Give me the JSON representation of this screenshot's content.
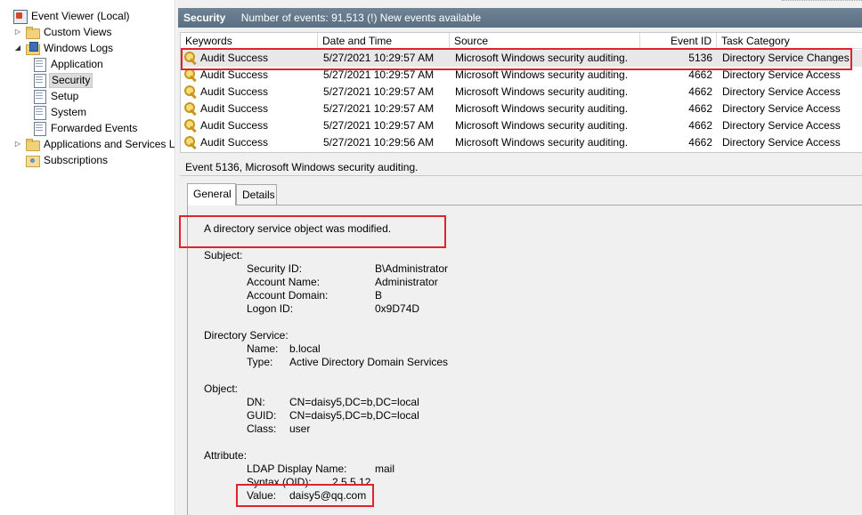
{
  "tree": {
    "items": [
      {
        "label": "Event Viewer (Local)",
        "icon": "event-viewer-icon",
        "expander": ""
      },
      {
        "label": "Custom Views",
        "icon": "folder-icon",
        "expander": "▷"
      },
      {
        "label": "Windows Logs",
        "icon": "folder-icon",
        "expander": "◢"
      },
      {
        "label": "Application",
        "icon": "log-icon",
        "expander": ""
      },
      {
        "label": "Security",
        "icon": "log-icon",
        "expander": "",
        "selected": true
      },
      {
        "label": "Setup",
        "icon": "log-icon",
        "expander": ""
      },
      {
        "label": "System",
        "icon": "log-icon",
        "expander": ""
      },
      {
        "label": "Forwarded Events",
        "icon": "log-icon",
        "expander": ""
      },
      {
        "label": "Applications and Services L",
        "icon": "folder-icon",
        "expander": "▷"
      },
      {
        "label": "Subscriptions",
        "icon": "subscriptions-icon",
        "expander": ""
      }
    ]
  },
  "header": {
    "title": "Security",
    "info": "Number of events: 91,513 (!) New events available"
  },
  "grid": {
    "columns": [
      "Keywords",
      "Date and Time",
      "Source",
      "Event ID",
      "Task Category"
    ],
    "rows": [
      {
        "keywords": "Audit Success",
        "datetime": "5/27/2021 10:29:57 AM",
        "source": "Microsoft Windows security auditing.",
        "event_id": "5136",
        "task": "Directory Service Changes"
      },
      {
        "keywords": "Audit Success",
        "datetime": "5/27/2021 10:29:57 AM",
        "source": "Microsoft Windows security auditing.",
        "event_id": "4662",
        "task": "Directory Service Access"
      },
      {
        "keywords": "Audit Success",
        "datetime": "5/27/2021 10:29:57 AM",
        "source": "Microsoft Windows security auditing.",
        "event_id": "4662",
        "task": "Directory Service Access"
      },
      {
        "keywords": "Audit Success",
        "datetime": "5/27/2021 10:29:57 AM",
        "source": "Microsoft Windows security auditing.",
        "event_id": "4662",
        "task": "Directory Service Access"
      },
      {
        "keywords": "Audit Success",
        "datetime": "5/27/2021 10:29:57 AM",
        "source": "Microsoft Windows security auditing.",
        "event_id": "4662",
        "task": "Directory Service Access"
      },
      {
        "keywords": "Audit Success",
        "datetime": "5/27/2021 10:29:56 AM",
        "source": "Microsoft Windows security auditing.",
        "event_id": "4662",
        "task": "Directory Service Access"
      }
    ]
  },
  "detail": {
    "title": "Event 5136, Microsoft Windows security auditing.",
    "tab_general": "General",
    "tab_details": "Details",
    "message": "A directory service object was modified.",
    "subject": {
      "heading": "Subject:",
      "security_id_label": "Security ID:",
      "security_id": "B\\Administrator",
      "account_name_label": "Account Name:",
      "account_name": "Administrator",
      "account_domain_label": "Account Domain:",
      "account_domain": "B",
      "logon_id_label": "Logon ID:",
      "logon_id": "0x9D74D"
    },
    "directory_service": {
      "heading": "Directory Service:",
      "name_label": "Name:",
      "name": "b.local",
      "type_label": "Type:",
      "type": "Active Directory Domain Services"
    },
    "object": {
      "heading": "Object:",
      "dn_label": "DN:",
      "dn": "CN=daisy5,DC=b,DC=local",
      "guid_label": "GUID:",
      "guid": "CN=daisy5,DC=b,DC=local",
      "class_label": "Class:",
      "class": "user"
    },
    "attribute": {
      "heading": "Attribute:",
      "ldap_label": "LDAP Display Name:",
      "ldap": "mail",
      "syntax_label": "Syntax (OID):",
      "syntax": "2.5.5.12",
      "value_label": "Value:",
      "value": "daisy5@qq.com"
    }
  },
  "colors": {
    "highlight": "#e0242b",
    "header_bg": "#5f7387",
    "selected_row": "#e8e8e8"
  }
}
